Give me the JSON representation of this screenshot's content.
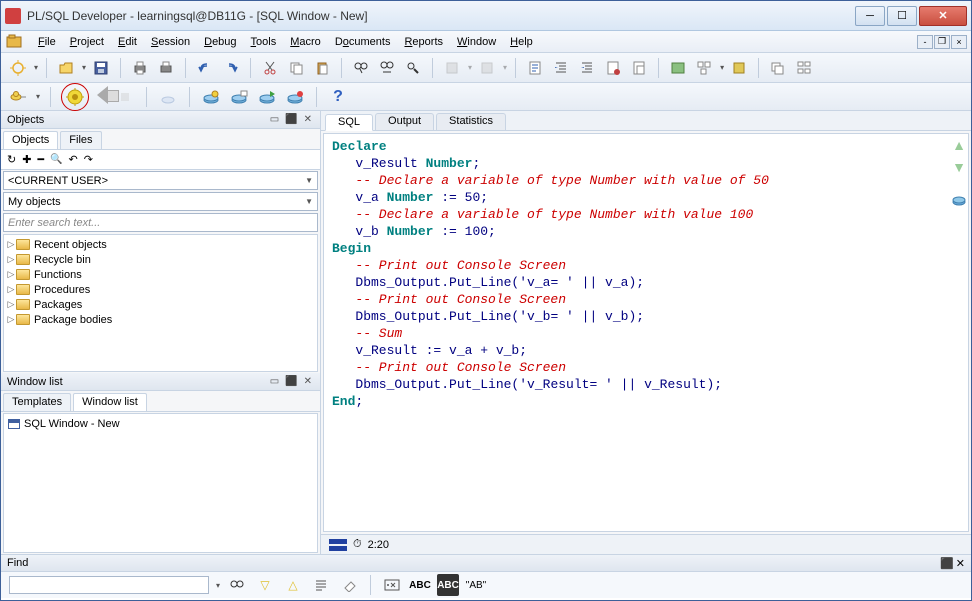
{
  "window": {
    "title": "PL/SQL Developer - learningsql@DB11G - [SQL Window - New]"
  },
  "menu": {
    "items": [
      "File",
      "Project",
      "Edit",
      "Session",
      "Debug",
      "Tools",
      "Macro",
      "Documents",
      "Reports",
      "Window",
      "Help"
    ]
  },
  "objects_panel": {
    "title": "Objects",
    "tabs": [
      "Objects",
      "Files"
    ],
    "user_combo": "<CURRENT USER>",
    "filter_combo": "My objects",
    "search_placeholder": "Enter search text...",
    "tree_items": [
      "Recent objects",
      "Recycle bin",
      "Functions",
      "Procedures",
      "Packages",
      "Package bodies"
    ]
  },
  "window_list": {
    "title": "Window list",
    "tabs": [
      "Templates",
      "Window list"
    ],
    "items": [
      "SQL Window - New"
    ]
  },
  "editor": {
    "tabs": [
      "SQL",
      "Output",
      "Statistics"
    ],
    "status_time": "2:20",
    "code": {
      "l1": "Declare",
      "l2": "   v_Result ",
      "l2b": "Number",
      "l2c": ";",
      "l3": "   -- Declare a variable of type Number with value of 50",
      "l4": "   v_a ",
      "l4b": "Number",
      "l4c": " := ",
      "l4d": "50",
      "l4e": ";",
      "l5": "   -- Declare a variable of type Number with value 100",
      "l6": "   v_b ",
      "l6b": "Number",
      "l6c": " := ",
      "l6d": "100",
      "l6e": ";",
      "l7": "Begin",
      "l8": "   -- Print out Console Screen",
      "l9": "   Dbms_Output.Put_Line(",
      "l9b": "'v_a= '",
      "l9c": " || v_a);",
      "l10": "   -- Print out Console Screen",
      "l11": "   Dbms_Output.Put_Line(",
      "l11b": "'v_b= '",
      "l11c": " || v_b);",
      "l12": "   -- Sum",
      "l13": "   v_Result := v_a + v_b;",
      "l14": "   -- Print out Console Screen",
      "l15": "   Dbms_Output.Put_Line(",
      "l15b": "'v_Result= '",
      "l15c": " || v_Result);",
      "l16": "End",
      "l16b": ";"
    }
  },
  "find": {
    "title": "Find",
    "literal": "\"AB\""
  }
}
